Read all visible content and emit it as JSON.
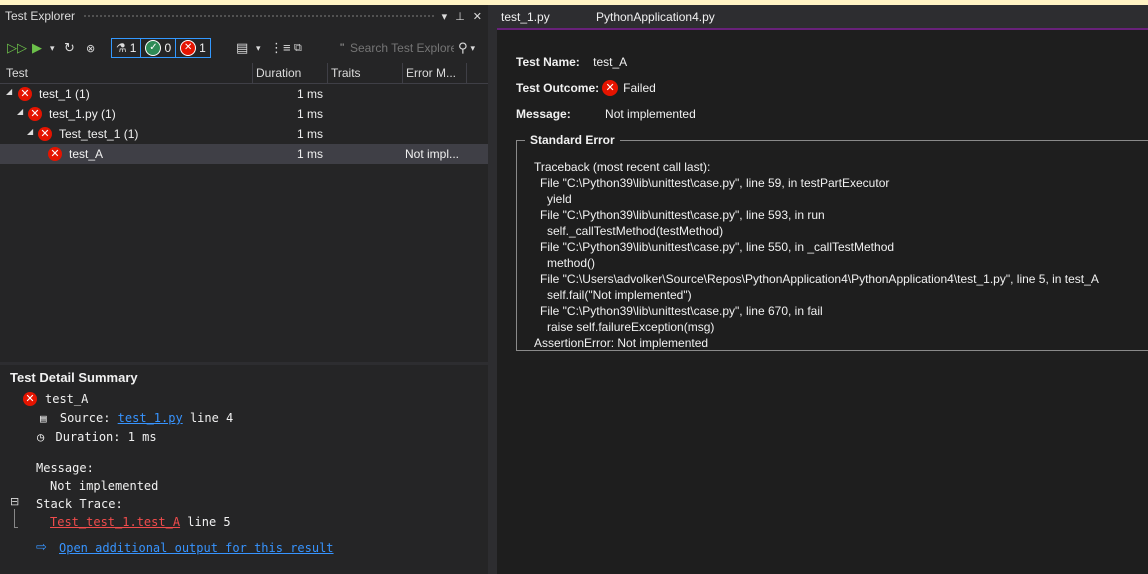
{
  "left": {
    "title": "Test Explorer",
    "title_icons": [
      "dropdown-arrow-icon",
      "pin-icon",
      "close-icon"
    ],
    "toolbar": {
      "filters": {
        "not_run_count": "1",
        "passed_count": "0",
        "failed_count": "1"
      },
      "search_placeholder": "Search Test Explore"
    },
    "columns": [
      "Test",
      "Duration",
      "Traits",
      "Error M..."
    ],
    "rows": [
      {
        "name": "test_1 (1)",
        "duration": "1 ms",
        "error": ""
      },
      {
        "name": "test_1.py (1)",
        "duration": "1 ms",
        "error": ""
      },
      {
        "name": "Test_test_1 (1)",
        "duration": "1 ms",
        "error": ""
      },
      {
        "name": "test_A",
        "duration": "1 ms",
        "error": "Not impl..."
      }
    ],
    "detail": {
      "heading": "Test Detail Summary",
      "test_name": "test_A",
      "source_label": "Source:",
      "source_link": "test_1.py",
      "source_line": "line 4",
      "duration_label": "Duration:",
      "duration_value": "1 ms",
      "message_label": "Message:",
      "message_value": "Not implemented",
      "stack_label": "Stack Trace:",
      "stack_link": "Test_test_1.test_A",
      "stack_line": "line 5",
      "open_output": "Open additional output for this result"
    }
  },
  "right": {
    "tabs": [
      "test_1.py",
      "PythonApplication4.py"
    ],
    "test_name_label": "Test Name:",
    "test_name": "test_A",
    "outcome_label": "Test Outcome:",
    "outcome": "Failed",
    "message_label": "Message:",
    "message": "Not implemented",
    "stderr_label": "Standard Error",
    "traceback": [
      "Traceback (most recent call last):",
      "  File \"C:\\Python39\\lib\\unittest\\case.py\", line 59, in testPartExecutor",
      "    yield",
      "  File \"C:\\Python39\\lib\\unittest\\case.py\", line 593, in run",
      "    self._callTestMethod(testMethod)",
      "  File \"C:\\Python39\\lib\\unittest\\case.py\", line 550, in _callTestMethod",
      "    method()",
      "  File \"C:\\Users\\advolker\\Source\\Repos\\PythonApplication4\\PythonApplication4\\test_1.py\", line 5, in test_A",
      "    self.fail(\"Not implemented\")",
      "  File \"C:\\Python39\\lib\\unittest\\case.py\", line 670, in fail",
      "    raise self.failureException(msg)",
      "AssertionError: Not implemented"
    ]
  }
}
